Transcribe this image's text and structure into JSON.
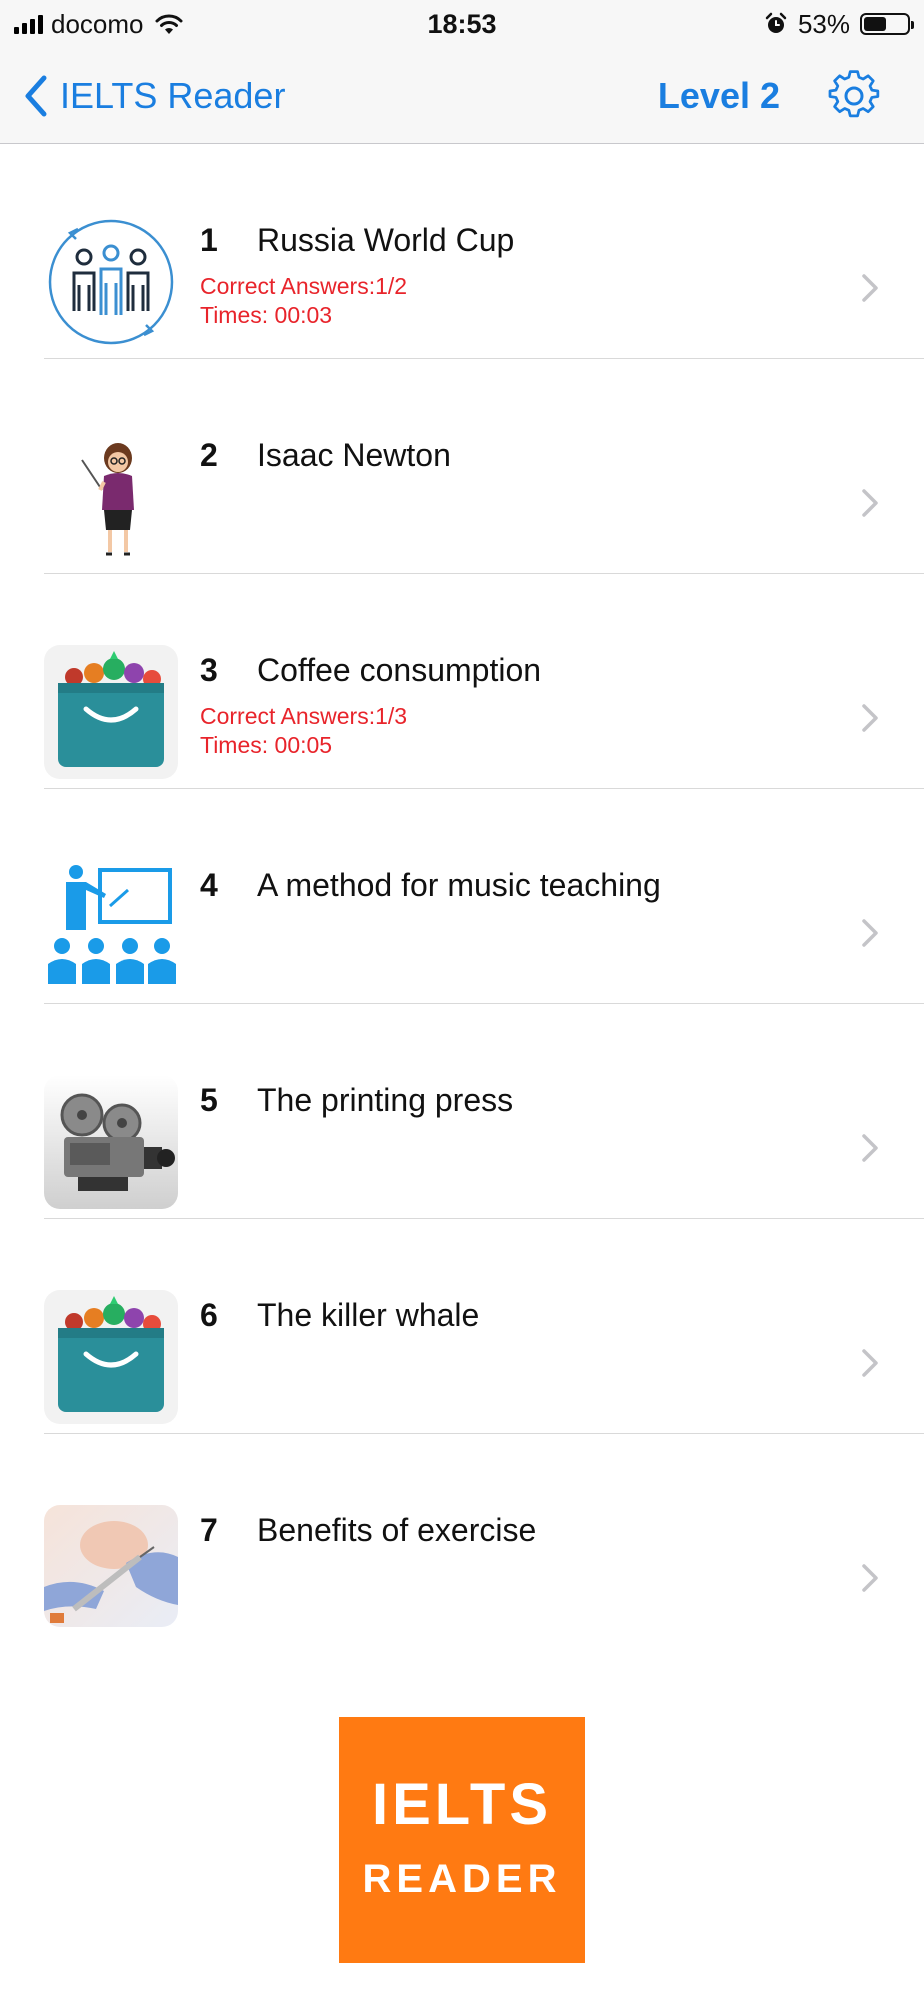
{
  "status_bar": {
    "carrier": "docomo",
    "time": "18:53",
    "battery_percent": "53%",
    "battery_level": 0.53
  },
  "nav": {
    "back_label": "IELTS Reader",
    "level_title": "Level 2",
    "accent_color": "#1a7ee0"
  },
  "lessons": [
    {
      "number": "1",
      "title": "Russia World Cup",
      "correct": "Correct Answers:1/2",
      "time": "Times: 00:03",
      "icon": "team-people-icon"
    },
    {
      "number": "2",
      "title": "Isaac Newton",
      "icon": "teacher-woman-icon"
    },
    {
      "number": "3",
      "title": "Coffee consumption",
      "correct": "Correct Answers:1/3",
      "time": "Times: 00:05",
      "icon": "vegetable-basket-icon"
    },
    {
      "number": "4",
      "title": "A method for music teaching",
      "icon": "classroom-presentation-icon"
    },
    {
      "number": "5",
      "title": "The printing press",
      "icon": "film-projector-icon"
    },
    {
      "number": "6",
      "title": "The killer whale",
      "icon": "vegetable-basket-icon"
    },
    {
      "number": "7",
      "title": "Benefits of exercise",
      "icon": "syringe-hands-photo"
    }
  ],
  "stat_color": "#e8242b",
  "logo": {
    "line1": "IELTS",
    "line2": "READER",
    "color": "#ff7a12"
  }
}
